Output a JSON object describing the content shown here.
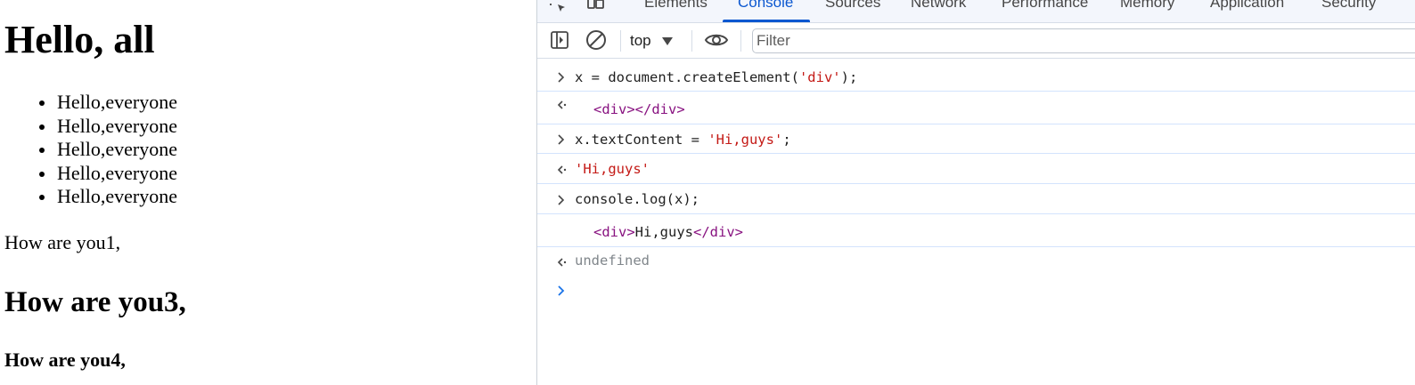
{
  "page": {
    "heading": "Hello, all",
    "list_items": [
      "Hello,everyone",
      "Hello,everyone",
      "Hello,everyone",
      "Hello,everyone",
      "Hello,everyone"
    ],
    "paragraph": "How are you1,",
    "subheading": "How are you3,",
    "small_heading": "How are you4,"
  },
  "devtools": {
    "tabs": [
      "Elements",
      "Console",
      "Sources",
      "Network",
      "Performance",
      "Memory",
      "Application",
      "Security"
    ],
    "active_tab": "Console",
    "context": "top",
    "filter_placeholder": "Filter",
    "colors": {
      "accent": "#0b57d0",
      "string": "#c41a16",
      "tag": "#881280",
      "undefined": "#80868b"
    },
    "console": [
      {
        "type": "input",
        "text": "x = document.createElement(",
        "str": "'div'",
        "tail": ");"
      },
      {
        "type": "result",
        "tag_open": "<div>",
        "tag_close": "</div>"
      },
      {
        "type": "input",
        "text": "x.textContent = ",
        "str": "'Hi,guys'",
        "tail": ";"
      },
      {
        "type": "result",
        "str": "'Hi,guys'"
      },
      {
        "type": "input",
        "text": "console.log(x);"
      },
      {
        "type": "log",
        "tag_open": "<div>",
        "text": "Hi,guys",
        "tag_close": "</div>"
      },
      {
        "type": "result",
        "text": "undefined"
      }
    ]
  }
}
